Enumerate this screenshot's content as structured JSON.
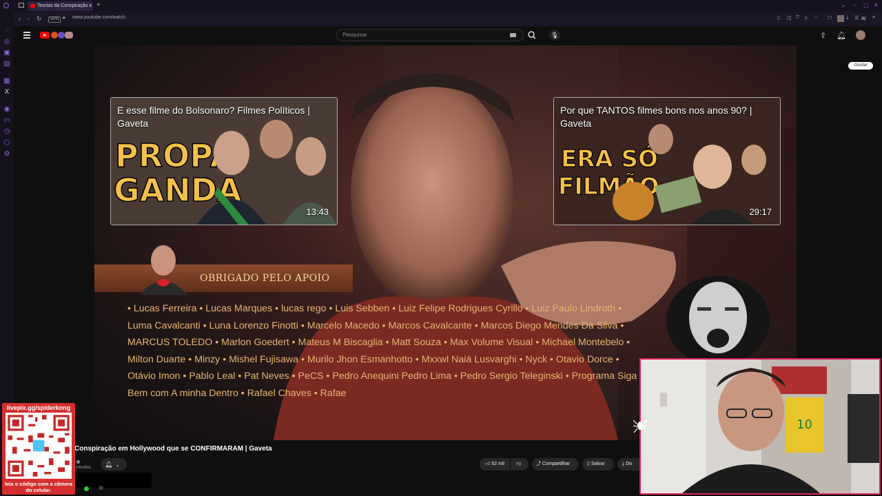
{
  "browser": {
    "tab_title": "Teorias da Conspiração e",
    "url": "www.youtube.com/watch",
    "vpn_label": "VPN",
    "ai_label": "AI"
  },
  "youtube": {
    "search_placeholder": "Pesquisar"
  },
  "video": {
    "end_cards": [
      {
        "title": "E esse filme do Bolsonaro? Filmes Políticos | Gaveta",
        "duration": "13:43",
        "art_text": "PROPA GANDA"
      },
      {
        "title": "Por que TANTOS filmes bons nos anos 90? | Gaveta",
        "duration": "29:17",
        "art_text": "ERA SÓ FILMÃO"
      }
    ],
    "support_banner": "OBRIGADO PELO APOIO",
    "supporters_text": "• Lucas Ferreira • Lucas Marques • lucas rego • Luis Sebben • Luiz Felipe Rodrigues Cyrillo • Luiz Paulo Lindroth • Luma Cavalcanti • Luna Lorenzo Finotti • Marcelo Macedo • Marcos Cavalcante • Marcos Diego Mendes Da Silva • MARCUS TOLEDO • Marlon Goedert • Mateus M Biscaglia • Matt Souza • Max Volume Visual • Michael Montebelo • Milton Duarte • Minzy • Mishel Fujisawa • Murilo Jhon Esmanhotto • Mxxwl Naiá Lusvarghi • Nyck • Otavio Dorce • Otávio Imon • Pablo Leal • Pat Neves • PeCS • Pedro Anequini Pedro Lima • Pedro Sergio Teleginski • Programa Siga Bem com A minha Dentro • Rafael Chaves • Rafae"
  },
  "below_video": {
    "title": "Conspiração em Hollywood que se CONFIRMARAM | Gaveta",
    "subscribers_label": "inscritos",
    "likes": "52 mil",
    "share_label": "Compartilhar",
    "save_label": "Salvar",
    "download_label": "Do"
  },
  "overlay": {
    "qr_url": "livepix.gg/spiderkong",
    "qr_caption": "leia o código com a câmera do celular.",
    "hide_label": "Ocultar"
  },
  "colors": {
    "yt_red": "#ff0000",
    "webcam_border": "#e0245e",
    "supporter_text": "#e7b571",
    "qr_bg": "#d32f2f"
  }
}
